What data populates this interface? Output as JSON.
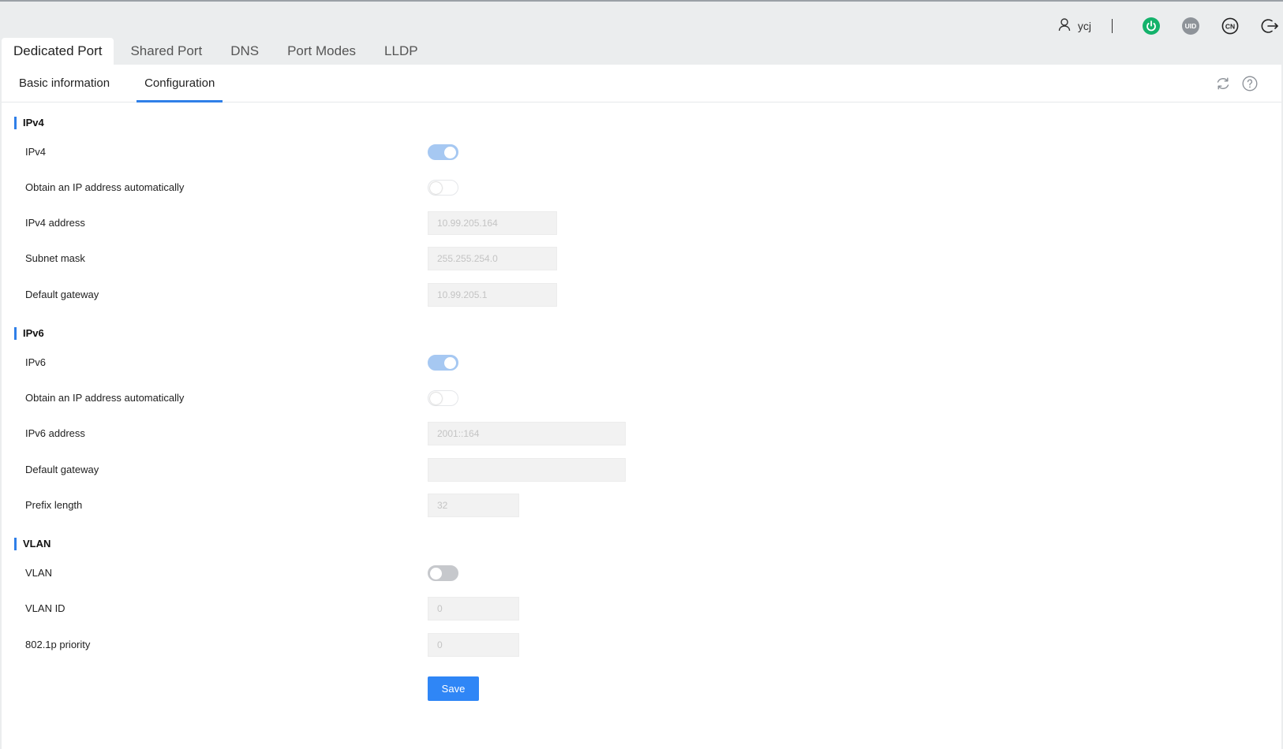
{
  "header": {
    "user_name": "ycj",
    "uid_label": "UID",
    "lang_label": "CN",
    "colors": {
      "power": "#13b26b",
      "uid": "#8e9399"
    }
  },
  "main_tabs": [
    {
      "label": "Dedicated Port",
      "active": true
    },
    {
      "label": "Shared Port",
      "active": false
    },
    {
      "label": "DNS",
      "active": false
    },
    {
      "label": "Port Modes",
      "active": false
    },
    {
      "label": "LLDP",
      "active": false
    }
  ],
  "sub_tabs": [
    {
      "label": "Basic information",
      "active": false
    },
    {
      "label": "Configuration",
      "active": true
    }
  ],
  "ipv4": {
    "title": "IPv4",
    "enable_label": "IPv4",
    "enable_value": true,
    "auto_label": "Obtain an IP address automatically",
    "auto_value": false,
    "address_label": "IPv4 address",
    "address_value": "10.99.205.164",
    "mask_label": "Subnet mask",
    "mask_value": "255.255.254.0",
    "gateway_label": "Default gateway",
    "gateway_value": "10.99.205.1"
  },
  "ipv6": {
    "title": "IPv6",
    "enable_label": "IPv6",
    "enable_value": true,
    "auto_label": "Obtain an IP address automatically",
    "auto_value": false,
    "address_label": "IPv6 address",
    "address_value": "2001::164",
    "gateway_label": "Default gateway",
    "gateway_value": "",
    "prefix_label": "Prefix length",
    "prefix_value": "32"
  },
  "vlan": {
    "title": "VLAN",
    "enable_label": "VLAN",
    "enable_value": false,
    "id_label": "VLAN ID",
    "id_value": "0",
    "priority_label": "802.1p priority",
    "priority_value": "0"
  },
  "save_label": "Save",
  "accent_color": "#2f7fe8"
}
